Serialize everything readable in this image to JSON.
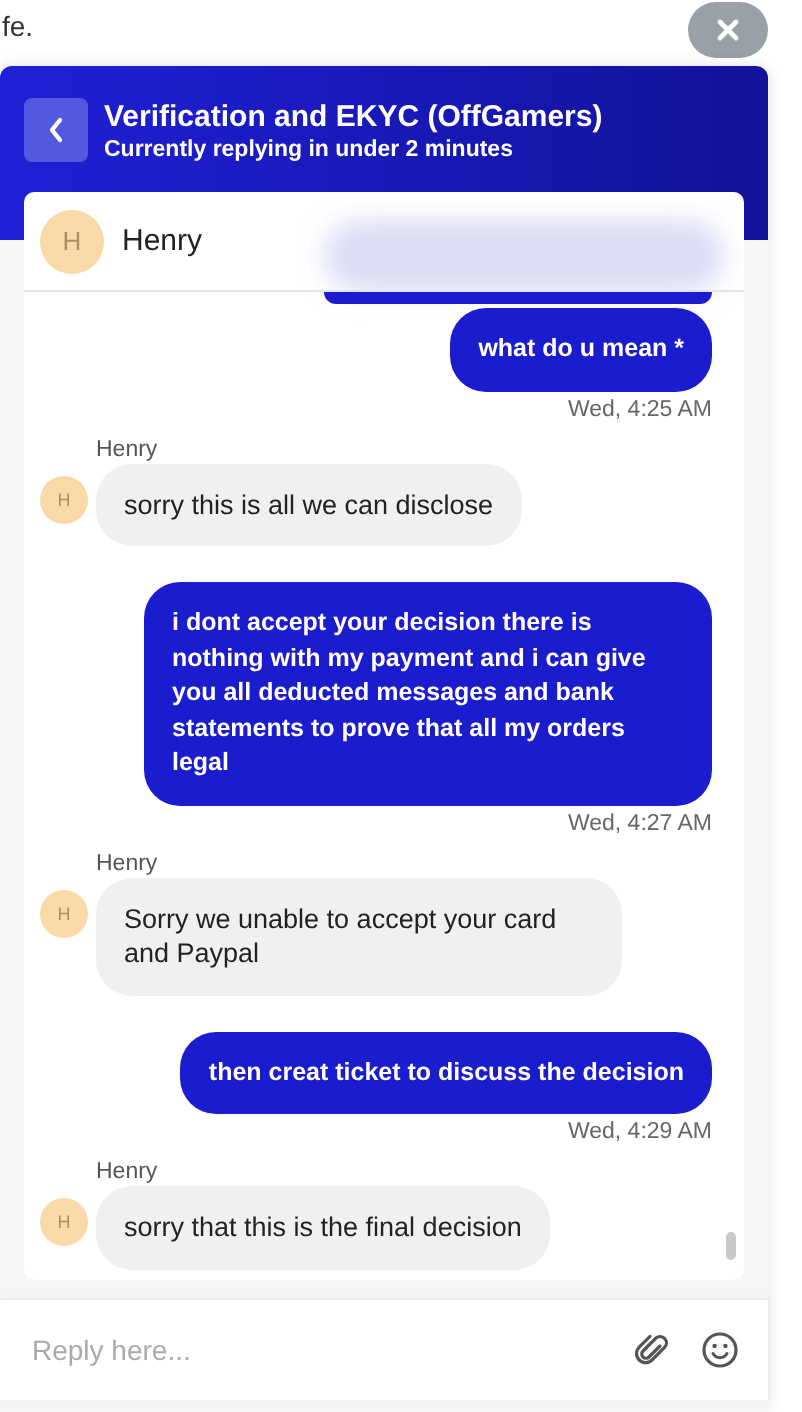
{
  "page_text": "fe.",
  "header": {
    "title": "Verification and EKYC (OffGamers)",
    "subtitle": "Currently replying in under 2 minutes"
  },
  "agent": {
    "initial": "H",
    "name": "Henry"
  },
  "messages": [
    {
      "kind": "sent",
      "text": "what do u mean *",
      "time": "Wed, 4:25 AM"
    },
    {
      "kind": "received",
      "sender": "Henry",
      "initial": "H",
      "text": "sorry this is all we can disclose"
    },
    {
      "kind": "sent",
      "text": "i dont accept your decision there is nothing with my payment and i can give you all deducted messages and bank statements to prove that all my orders legal",
      "time": "Wed, 4:27 AM"
    },
    {
      "kind": "received",
      "sender": "Henry",
      "initial": "H",
      "text": "Sorry we unable to accept your card and Paypal"
    },
    {
      "kind": "sent",
      "text": "then creat ticket to discuss the decision",
      "time": "Wed, 4:29 AM"
    },
    {
      "kind": "received",
      "sender": "Henry",
      "initial": "H",
      "text": "sorry that this is the final decision"
    }
  ],
  "composer": {
    "placeholder": "Reply here..."
  }
}
